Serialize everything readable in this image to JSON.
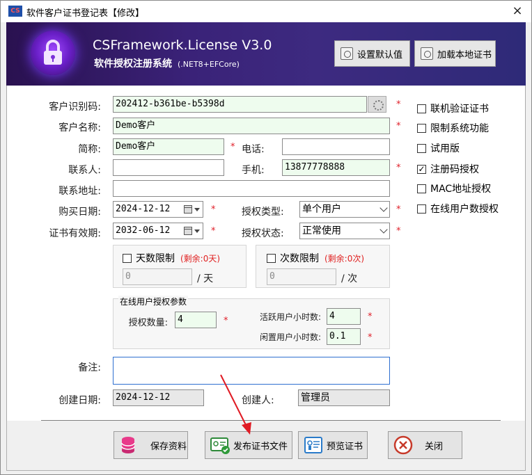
{
  "window": {
    "app_icon": "CS",
    "title": "软件客户证书登记表【修改】",
    "close_glyph": "×"
  },
  "banner": {
    "product_name": "CSFramework.License V3.0",
    "product_subtitle": "软件授权注册系统",
    "product_tech": "(.NET8+EFCore)",
    "btn_set_default": "设置默认值",
    "btn_load_local": "加载本地证书"
  },
  "form": {
    "customer_id_label": "客户识别码:",
    "customer_id_value": "202412-b361be-b5398d",
    "customer_name_label": "客户名称:",
    "customer_name_value": "Demo客户",
    "short_name_label": "简称:",
    "short_name_value": "Demo客户",
    "phone_label": "电话:",
    "phone_value": "",
    "contact_label": "联系人:",
    "contact_value": "",
    "mobile_label": "手机:",
    "mobile_value": "13877778888",
    "address_label": "联系地址:",
    "address_value": "",
    "purchase_date_label": "购买日期:",
    "purchase_date_value": "2024-12-12",
    "license_type_label": "授权类型:",
    "license_type_value": "单个用户",
    "expiry_label": "证书有效期:",
    "expiry_value": "2032-06-12",
    "license_status_label": "授权状态:",
    "license_status_value": "正常使用",
    "days_limit_label": "天数限制",
    "days_remain": "(剩余:0天)",
    "days_value": "0",
    "days_unit": "/ 天",
    "count_limit_label": "次数限制",
    "count_remain": "(剩余:0次)",
    "count_value": "0",
    "count_unit": "/ 次",
    "online_group_title": "在线用户授权参数",
    "auth_count_label": "授权数量:",
    "auth_count_value": "4",
    "active_hours_label": "活跃用户小时数:",
    "active_hours_value": "4",
    "idle_hours_label": "闲置用户小时数:",
    "idle_hours_value": "0.1",
    "remark_label": "备注:",
    "remark_value": "",
    "created_date_label": "创建日期:",
    "created_date_value": "2024-12-12",
    "creator_label": "创建人:",
    "creator_value": "管理员",
    "required_mark": "*"
  },
  "options": {
    "online_verify": "联机验证证书",
    "limit_features": "限制系统功能",
    "trial": "试用版",
    "regcode_auth": "注册码授权",
    "mac_auth": "MAC地址授权",
    "online_users_auth": "在线用户数授权",
    "checked_glyph": "✓"
  },
  "buttons": {
    "save": "保存资料",
    "publish": "发布证书文件",
    "preview": "预览证书",
    "close": "关闭"
  },
  "colors": {
    "banner_bg": "#3a2278",
    "required": "#e0202a",
    "accent_green": "#eefcee",
    "arrow": "#e01b24"
  }
}
